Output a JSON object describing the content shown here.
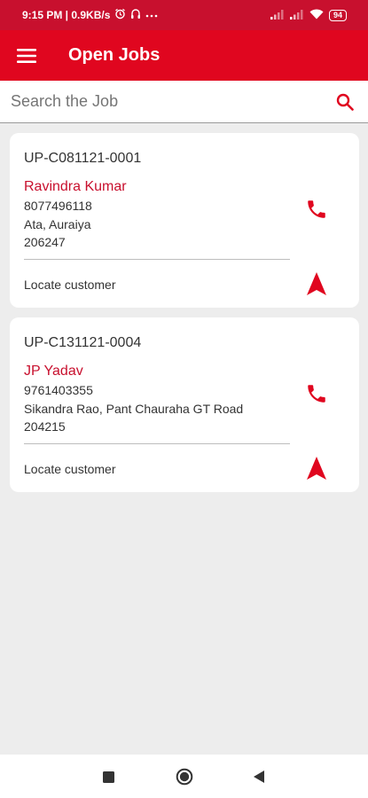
{
  "status_bar": {
    "time_speed": "9:15 PM | 0.9KB/s",
    "battery": "94",
    "icons": [
      "alarm-icon",
      "headset-icon",
      "more-dots-icon",
      "signal-icon",
      "signal-icon",
      "wifi-icon",
      "battery-icon"
    ]
  },
  "app_bar": {
    "title": "Open Jobs",
    "menu_icon": "hamburger-menu-icon",
    "background": "#e0061f"
  },
  "search": {
    "placeholder": "Search the Job",
    "icon": "search-icon",
    "icon_color": "#e0061f"
  },
  "jobs": [
    {
      "id": "UP-C081121-0001",
      "name": "Ravindra Kumar",
      "phone": "8077496118",
      "address": "Ata, Auraiya",
      "pin": "206247",
      "locate_label": "Locate customer"
    },
    {
      "id": "UP-C131121-0004",
      "name": "JP Yadav",
      "phone": "9761403355",
      "address": "Sikandra Rao, Pant Chauraha GT Road",
      "pin": "204215",
      "locate_label": "Locate customer"
    }
  ],
  "colors": {
    "accent": "#e0061f",
    "name_text": "#c8102e",
    "background": "#ededed"
  },
  "bottom_nav": [
    "recents-square-icon",
    "home-circle-icon",
    "back-triangle-icon"
  ]
}
